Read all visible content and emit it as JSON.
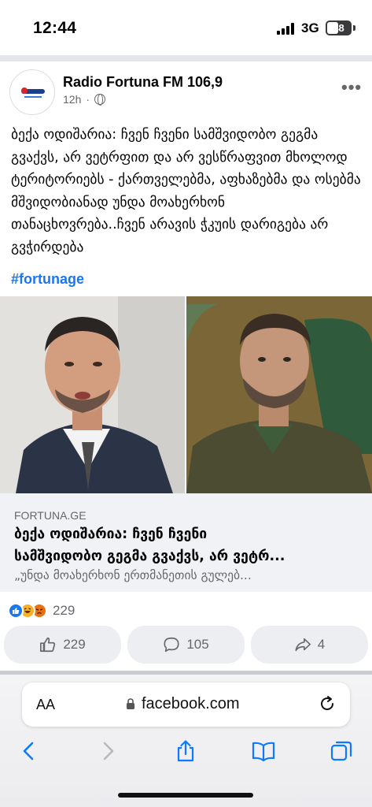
{
  "status_bar": {
    "time": "12:44",
    "network": "3G",
    "battery": "48"
  },
  "post": {
    "page_name": "Radio Fortuna FM 106,9",
    "time_ago": "12h",
    "separator": "·",
    "more_label": "•••",
    "text": "ბექა ოდიშარია: ჩვენ ჩვენი სამშვიდობო გეგმა გვაქვს, არ ვეტრფით და არ ვესწრაფვით მხოლოდ ტერიტორიებს - ქართველებმა, აფხაზებმა და ოსებმა მშვიდობიანად უნდა მოახერხონ თანაცხოვრება..ჩვენ არავის ჭკუის დარიგება არ გვჭირდება",
    "hashtag": "#fortunage"
  },
  "link_preview": {
    "domain": "FORTUNA.GE",
    "title_line1": "ბექა ოდიშარია: ჩვენ ჩვენი",
    "title_line2": "სამშვიდობო გეგმა გვაქვს, არ ვეტრ...",
    "description": "„უნდა მოახერხონ ერთმანეთის გულებ..."
  },
  "reactions": {
    "count": "229",
    "types": [
      "like",
      "haha",
      "angry"
    ]
  },
  "actions": {
    "like_count": "229",
    "comment_count": "105",
    "share_count": "4"
  },
  "browser": {
    "aa_label": "AA",
    "url": "facebook.com"
  },
  "colors": {
    "accent": "#1877f2",
    "muted": "#65676b",
    "button_bg": "#eceef1",
    "ios_blue": "#0a7aff"
  }
}
